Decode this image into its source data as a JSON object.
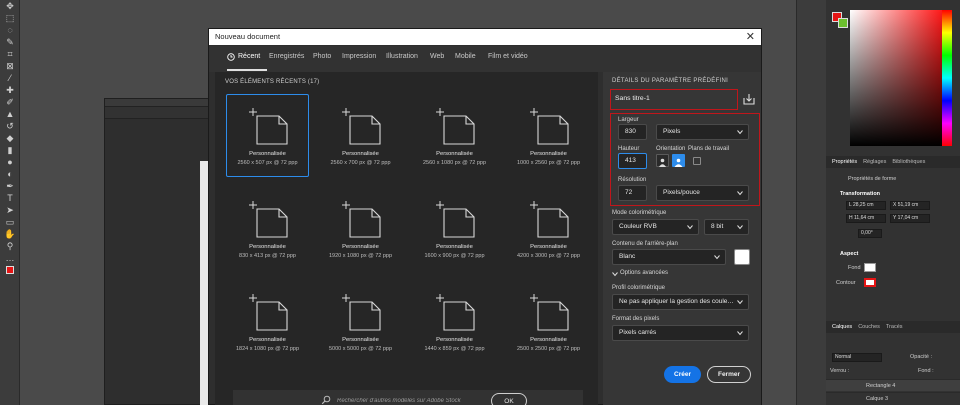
{
  "dialog": {
    "title": "Nouveau document",
    "tabs": [
      {
        "label": "Récent"
      },
      {
        "label": "Enregistrés"
      },
      {
        "label": "Photo"
      },
      {
        "label": "Impression"
      },
      {
        "label": "Illustration"
      },
      {
        "label": "Web"
      },
      {
        "label": "Mobile"
      },
      {
        "label": "Film et vidéo"
      }
    ],
    "recent_title": "VOS ÉLÉMENTS RÉCENTS",
    "recent_count": "(17)",
    "presets": [
      {
        "name": "Personnalisée",
        "size": "2560 x 507 px @ 72 ppp",
        "selected": true
      },
      {
        "name": "Personnalisée",
        "size": "2560 x 700 px @ 72 ppp"
      },
      {
        "name": "Personnalisée",
        "size": "2560 x 1080 px @ 72 ppp"
      },
      {
        "name": "Personnalisée",
        "size": "1000 x 2560 px @ 72 ppp"
      },
      {
        "name": "Personnalisée",
        "size": "830 x 413 px @ 72 ppp"
      },
      {
        "name": "Personnalisée",
        "size": "1920 x 1080 px @ 72 ppp"
      },
      {
        "name": "Personnalisée",
        "size": "1600 x 900 px @ 72 ppp"
      },
      {
        "name": "Personnalisée",
        "size": "4200 x 3000 px @ 72 ppp"
      },
      {
        "name": "Personnalisée",
        "size": "1824 x 1080 px @ 72 ppp"
      },
      {
        "name": "Personnalisée",
        "size": "5000 x 5000 px @ 72 ppp"
      },
      {
        "name": "Personnalisée",
        "size": "1440 x 859 px @ 72 ppp"
      },
      {
        "name": "Personnalisée",
        "size": "2500 x 2500 px @ 72 ppp"
      }
    ],
    "search_placeholder": "Rechercher d'autres modèles sur Adobe Stock",
    "ok_label": "OK",
    "details": {
      "section_title": "DÉTAILS DU PARAMÈTRE PRÉDÉFINI",
      "doc_name": "Sans titre-1",
      "width_label": "Largeur",
      "width_value": "830",
      "width_unit": "Pixels",
      "height_label": "Hauteur",
      "height_value": "413",
      "orientation_label": "Orientation",
      "artboards_label": "Plans de travail",
      "resolution_label": "Résolution",
      "resolution_value": "72",
      "resolution_unit": "Pixels/pouce",
      "color_mode_label": "Mode colorimétrique",
      "color_mode_value": "Couleur RVB",
      "bit_depth": "8 bit",
      "background_label": "Contenu de l'arrière-plan",
      "background_value": "Blanc",
      "advanced_label": "Options avancées",
      "color_profile_label": "Profil colorimétrique",
      "color_profile_value": "Ne pas appliquer la gestion des coule…",
      "pixel_format_label": "Format des pixels",
      "pixel_format_value": "Pixels carrés"
    },
    "create_label": "Créer",
    "close_label": "Fermer"
  },
  "right_panel": {
    "tabs": [
      "Propriétés",
      "Réglages",
      "Bibliothèques"
    ],
    "shape_props": "Propriétés de forme",
    "transform_label": "Transformation",
    "w": "L  28,25 cm",
    "x": "X  51,19 cm",
    "h": "H  11,64 cm",
    "y": "Y  17,04 cm",
    "angle": "0,00°",
    "aspect_label": "Aspect",
    "fill_label": "Fond",
    "stroke_label": "Contour",
    "layer_tabs": [
      "Calques",
      "Couches",
      "Tracés"
    ],
    "blend_mode": "Normal",
    "opacity_label": "Opacité :",
    "lock_label": "Verrou :",
    "fill_pct_label": "Fond :",
    "layers": [
      "Rectangle 4",
      "Calque 3"
    ]
  },
  "colors": {
    "accent": "#1473e6",
    "selection": "#2d8ceb",
    "highlight_red": "#c0161b",
    "fg_swatch": "#e51515",
    "bg_swatch": "#6cbf2e"
  }
}
